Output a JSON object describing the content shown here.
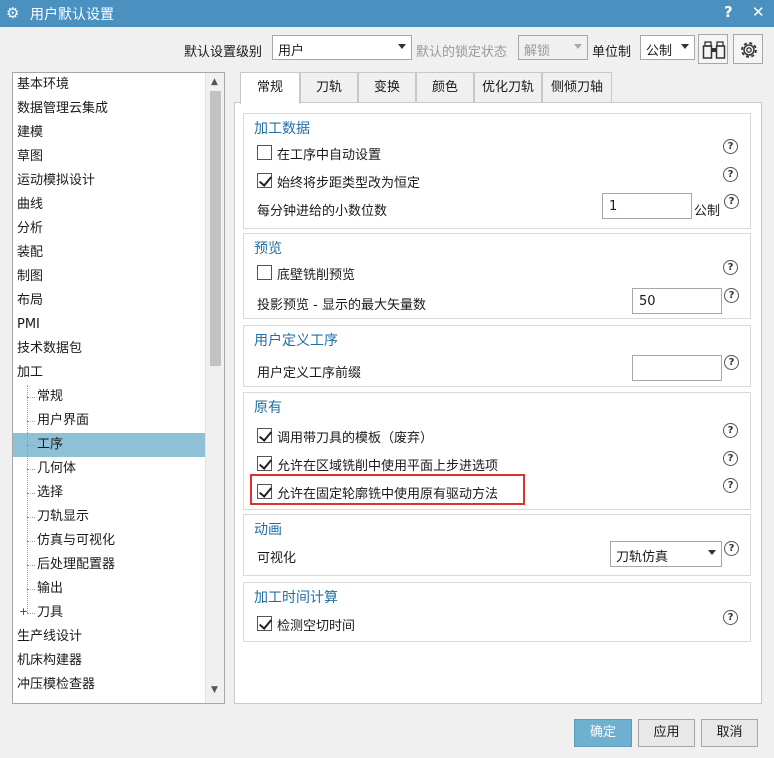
{
  "window": {
    "title": "用户默认设置",
    "help_label": "?",
    "close_label": "✕"
  },
  "toolbar": {
    "level_label": "默认设置级别",
    "level_value": "用户",
    "lock_label": "默认的锁定状态",
    "lock_value": "解锁",
    "units_label": "单位制",
    "units_value": "公制"
  },
  "tree": {
    "items": [
      {
        "label": "基本环境",
        "level": 0
      },
      {
        "label": "数据管理云集成",
        "level": 0
      },
      {
        "label": "建模",
        "level": 0
      },
      {
        "label": "草图",
        "level": 0
      },
      {
        "label": "运动模拟设计",
        "level": 0
      },
      {
        "label": "曲线",
        "level": 0
      },
      {
        "label": "分析",
        "level": 0
      },
      {
        "label": "装配",
        "level": 0
      },
      {
        "label": "制图",
        "level": 0
      },
      {
        "label": "布局",
        "level": 0
      },
      {
        "label": "PMI",
        "level": 0
      },
      {
        "label": "技术数据包",
        "level": 0
      },
      {
        "label": "加工",
        "level": 0
      },
      {
        "label": "常规",
        "level": 1
      },
      {
        "label": "用户界面",
        "level": 1
      },
      {
        "label": "工序",
        "level": 1
      },
      {
        "label": "几何体",
        "level": 1
      },
      {
        "label": "选择",
        "level": 1
      },
      {
        "label": "刀轨显示",
        "level": 1
      },
      {
        "label": "仿真与可视化",
        "level": 1
      },
      {
        "label": "后处理配置器",
        "level": 1
      },
      {
        "label": "输出",
        "level": 1
      },
      {
        "label": "刀具",
        "level": 1
      },
      {
        "label": "生产线设计",
        "level": 0
      },
      {
        "label": "机床构建器",
        "level": 0
      },
      {
        "label": "冲压模检查器",
        "level": 0
      }
    ],
    "selected": "工序"
  },
  "tabs": [
    "常规",
    "刀轨",
    "变换",
    "颜色",
    "优化刀轨",
    "侧倾刀轴"
  ],
  "groups": {
    "machining_data": {
      "title": "加工数据",
      "auto_setup": {
        "label": "在工序中自动设置",
        "checked": false
      },
      "stepover_const": {
        "label": "始终将步距类型改为恒定",
        "checked": true
      },
      "feed_decimals": {
        "label": "每分钟进给的小数位数",
        "value": "1",
        "unit": "公制"
      }
    },
    "preview": {
      "title": "预览",
      "floor_wall": {
        "label": "底壁铣削预览",
        "checked": false
      },
      "max_vectors": {
        "label": "投影预览 - 显示的最大矢量数",
        "value": "50"
      }
    },
    "user_op": {
      "title": "用户定义工序",
      "prefix": {
        "label": "用户定义工序前缀",
        "value": ""
      }
    },
    "legacy": {
      "title": "原有",
      "template": {
        "label": "调用带刀具的模板（废弃）",
        "checked": true
      },
      "area_milling": {
        "label": "允许在区域铣削中使用平面上步进选项",
        "checked": true
      },
      "contour_drive": {
        "label": "允许在固定轮廓铣中使用原有驱动方法",
        "checked": true
      }
    },
    "animation": {
      "title": "动画",
      "visualize": {
        "label": "可视化",
        "value": "刀轨仿真"
      }
    },
    "time_calc": {
      "title": "加工时间计算",
      "detect_cut": {
        "label": "检测空切时间",
        "checked": true
      }
    }
  },
  "help_glyph": "?",
  "buttons": {
    "ok": "确定",
    "apply": "应用",
    "cancel": "取消"
  },
  "colors": {
    "titlebar": "#4a91c0",
    "accent": "#1f6fa6",
    "selected": "#8ec1d6",
    "highlight": "#e0312b",
    "primary_btn": "#6fb0d0"
  }
}
